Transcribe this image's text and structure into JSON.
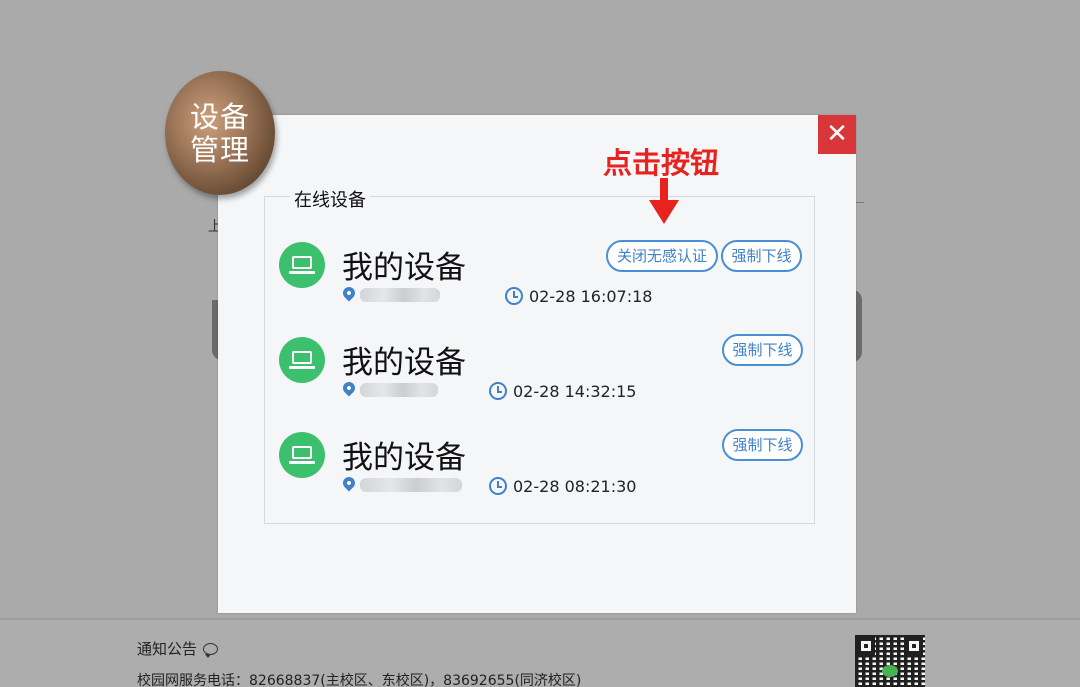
{
  "background": {
    "notice_label": "通知公告",
    "hotline": "校园网服务电话：82668837(主校区、东校区)，83692655(同济校区)",
    "fragment_char": "上"
  },
  "modal": {
    "badge_line1": "设备",
    "badge_line2": "管理",
    "close_label": "✕",
    "section_title": "在线设备",
    "devices": [
      {
        "name": "我的设备",
        "time": "02-28 16:07:18",
        "buttons": [
          "关闭无感认证",
          "强制下线"
        ]
      },
      {
        "name": "我的设备",
        "time": "02-28 14:32:15",
        "buttons": [
          "强制下线"
        ]
      },
      {
        "name": "我的设备",
        "time": "02-28 08:21:30",
        "buttons": [
          "强制下线"
        ]
      }
    ]
  },
  "annotation": {
    "text": "点击按钮"
  },
  "colors": {
    "accent_blue": "#3f82c9",
    "device_green": "#3cc06e",
    "close_red": "#d9363a",
    "annotation_red": "#e8231f"
  },
  "icons": {
    "device": "laptop-icon",
    "location": "location-pin-icon",
    "time": "clock-icon",
    "notice": "speech-bubble-icon",
    "close": "close-icon"
  }
}
